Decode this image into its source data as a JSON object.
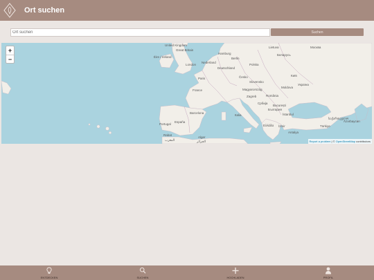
{
  "header": {
    "title": "Ort suchen",
    "logo_icon": "diamond-logo-icon"
  },
  "search": {
    "placeholder": "Ort suchen",
    "button_label": "Suchen"
  },
  "map": {
    "zoom_in": "+",
    "zoom_out": "−",
    "attribution_link": "Report a problem",
    "attribution_sep": " | © ",
    "attribution_osm": "OpenStreetMap",
    "attribution_suffix": " contributors",
    "labels": {
      "uk": "United Kingdom",
      "gb": "Great Britain",
      "eire": "Éire / Ireland",
      "london": "London",
      "nederland": "Nederland",
      "hamburg": "Hamburg",
      "berlin": "Berlin",
      "deutschland": "Deutschland",
      "polska": "Polska",
      "lietuva": "Lietuva",
      "belarus": "Беларусь",
      "moskva": "Москва",
      "paris": "Paris",
      "france": "France",
      "cesko": "Česko",
      "slovensko": "Slovensko",
      "kyiv": "Київ",
      "ukraina": "Україна",
      "magyar": "Magyarország",
      "moldova": "Moldova",
      "zagreb": "Zagreb",
      "romania": "România",
      "srbija": "Србија",
      "bucuresti": "București",
      "barcelona": "Barcelona",
      "italia": "Italia",
      "bulgaria": "България",
      "portugal": "Portugal",
      "espana": "España",
      "ellada": "Ελλάδα",
      "izmir": "İzmir",
      "istanbul": "İstanbul",
      "turkiye": "Türkiye",
      "antalya": "Antalya",
      "georgia": "საქართველო",
      "azerbaijan": "Azərbaycan",
      "rabat": "Rabat",
      "maghrib": "المغرب",
      "alger": "Alger",
      "algerie": "الجزائر"
    }
  },
  "bottom_nav": [
    {
      "label": "ENTDECKEN",
      "icon": "lightbulb-icon"
    },
    {
      "label": "SUCHEN",
      "icon": "search-icon"
    },
    {
      "label": "HOCHLADEN",
      "icon": "plus-icon"
    },
    {
      "label": "PROFIL",
      "icon": "user-icon"
    }
  ],
  "colors": {
    "bar": "#a68b80",
    "background": "#ebe6e3",
    "sea": "#aad3df",
    "land": "#f2efe9"
  }
}
